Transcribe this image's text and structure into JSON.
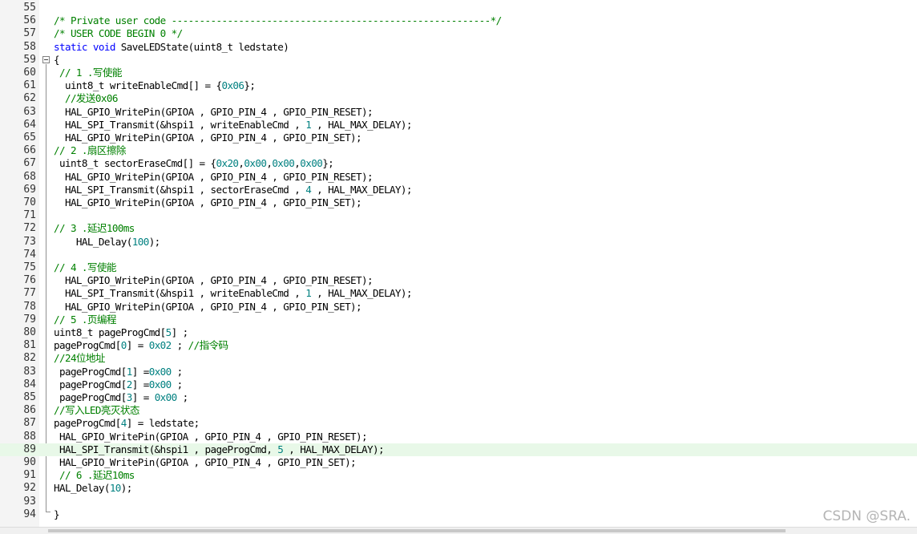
{
  "editor": {
    "current_line": 89,
    "lines": [
      {
        "n": "55",
        "tokens": []
      },
      {
        "n": "56",
        "tokens": [
          {
            "t": "/* Private user code ---------------------------------------------------------*/",
            "c": "cm"
          }
        ]
      },
      {
        "n": "57",
        "tokens": [
          {
            "t": "/* USER CODE BEGIN 0 */",
            "c": "cm"
          }
        ]
      },
      {
        "n": "58",
        "tokens": [
          {
            "t": "static",
            "c": "kw"
          },
          {
            "t": " "
          },
          {
            "t": "void",
            "c": "kw"
          },
          {
            "t": " SaveLEDState(uint8_t ledstate)"
          }
        ]
      },
      {
        "n": "59",
        "tokens": [
          {
            "t": "{"
          }
        ]
      },
      {
        "n": "60",
        "tokens": [
          {
            "t": " // 1 .写使能",
            "c": "cm"
          }
        ]
      },
      {
        "n": "61",
        "tokens": [
          {
            "t": "  uint8_t writeEnableCmd[] = {"
          },
          {
            "t": "0x06",
            "c": "num"
          },
          {
            "t": "};"
          }
        ]
      },
      {
        "n": "62",
        "tokens": [
          {
            "t": "  //发送0x06",
            "c": "cm"
          }
        ]
      },
      {
        "n": "63",
        "tokens": [
          {
            "t": "  HAL_GPIO_WritePin(GPIOA , GPIO_PIN_4 , GPIO_PIN_RESET);"
          }
        ]
      },
      {
        "n": "64",
        "tokens": [
          {
            "t": "  HAL_SPI_Transmit(&hspi1 , writeEnableCmd , "
          },
          {
            "t": "1",
            "c": "num"
          },
          {
            "t": " , HAL_MAX_DELAY);"
          }
        ]
      },
      {
        "n": "65",
        "tokens": [
          {
            "t": "  HAL_GPIO_WritePin(GPIOA , GPIO_PIN_4 , GPIO_PIN_SET);"
          }
        ]
      },
      {
        "n": "66",
        "tokens": [
          {
            "t": "// 2 .扇区擦除",
            "c": "cm"
          }
        ]
      },
      {
        "n": "67",
        "tokens": [
          {
            "t": " uint8_t sectorEraseCmd[] = {"
          },
          {
            "t": "0x20",
            "c": "num"
          },
          {
            "t": ","
          },
          {
            "t": "0x00",
            "c": "num"
          },
          {
            "t": ","
          },
          {
            "t": "0x00",
            "c": "num"
          },
          {
            "t": ","
          },
          {
            "t": "0x00",
            "c": "num"
          },
          {
            "t": "};"
          }
        ]
      },
      {
        "n": "68",
        "tokens": [
          {
            "t": "  HAL_GPIO_WritePin(GPIOA , GPIO_PIN_4 , GPIO_PIN_RESET);"
          }
        ]
      },
      {
        "n": "69",
        "tokens": [
          {
            "t": "  HAL_SPI_Transmit(&hspi1 , sectorEraseCmd , "
          },
          {
            "t": "4",
            "c": "num"
          },
          {
            "t": " , HAL_MAX_DELAY);"
          }
        ]
      },
      {
        "n": "70",
        "tokens": [
          {
            "t": "  HAL_GPIO_WritePin(GPIOA , GPIO_PIN_4 , GPIO_PIN_SET);"
          }
        ]
      },
      {
        "n": "71",
        "tokens": []
      },
      {
        "n": "72",
        "tokens": [
          {
            "t": "// 3 .延迟100ms",
            "c": "cm"
          }
        ]
      },
      {
        "n": "73",
        "tokens": [
          {
            "t": "    HAL_Delay("
          },
          {
            "t": "100",
            "c": "num"
          },
          {
            "t": ");"
          }
        ]
      },
      {
        "n": "74",
        "tokens": []
      },
      {
        "n": "75",
        "tokens": [
          {
            "t": "// 4 .写使能",
            "c": "cm"
          }
        ]
      },
      {
        "n": "76",
        "tokens": [
          {
            "t": "  HAL_GPIO_WritePin(GPIOA , GPIO_PIN_4 , GPIO_PIN_RESET);"
          }
        ]
      },
      {
        "n": "77",
        "tokens": [
          {
            "t": "  HAL_SPI_Transmit(&hspi1 , writeEnableCmd , "
          },
          {
            "t": "1",
            "c": "num"
          },
          {
            "t": " , HAL_MAX_DELAY);"
          }
        ]
      },
      {
        "n": "78",
        "tokens": [
          {
            "t": "  HAL_GPIO_WritePin(GPIOA , GPIO_PIN_4 , GPIO_PIN_SET);"
          }
        ]
      },
      {
        "n": "79",
        "tokens": [
          {
            "t": "// 5 .页编程",
            "c": "cm"
          }
        ]
      },
      {
        "n": "80",
        "tokens": [
          {
            "t": "uint8_t pageProgCmd["
          },
          {
            "t": "5",
            "c": "num"
          },
          {
            "t": "] ;"
          }
        ]
      },
      {
        "n": "81",
        "tokens": [
          {
            "t": "pageProgCmd["
          },
          {
            "t": "0",
            "c": "num"
          },
          {
            "t": "] = "
          },
          {
            "t": "0x02",
            "c": "num"
          },
          {
            "t": " ; "
          },
          {
            "t": "//指令码",
            "c": "cm"
          }
        ]
      },
      {
        "n": "82",
        "tokens": [
          {
            "t": "//24位地址",
            "c": "cm"
          }
        ]
      },
      {
        "n": "83",
        "tokens": [
          {
            "t": " pageProgCmd["
          },
          {
            "t": "1",
            "c": "num"
          },
          {
            "t": "] ="
          },
          {
            "t": "0x00",
            "c": "num"
          },
          {
            "t": " ;"
          }
        ]
      },
      {
        "n": "84",
        "tokens": [
          {
            "t": " pageProgCmd["
          },
          {
            "t": "2",
            "c": "num"
          },
          {
            "t": "] ="
          },
          {
            "t": "0x00",
            "c": "num"
          },
          {
            "t": " ;"
          }
        ]
      },
      {
        "n": "85",
        "tokens": [
          {
            "t": " pageProgCmd["
          },
          {
            "t": "3",
            "c": "num"
          },
          {
            "t": "] = "
          },
          {
            "t": "0x00",
            "c": "num"
          },
          {
            "t": " ;"
          }
        ]
      },
      {
        "n": "86",
        "tokens": [
          {
            "t": "//写入LED亮灭状态",
            "c": "cm"
          }
        ]
      },
      {
        "n": "87",
        "tokens": [
          {
            "t": "pageProgCmd["
          },
          {
            "t": "4",
            "c": "num"
          },
          {
            "t": "] = ledstate;"
          }
        ]
      },
      {
        "n": "88",
        "tokens": [
          {
            "t": " HAL_GPIO_WritePin(GPIOA , GPIO_PIN_4 , GPIO_PIN_RESET);"
          }
        ]
      },
      {
        "n": "89",
        "tokens": [
          {
            "t": " HAL_SPI_Transmit(&hspi1 , pageProgCmd, "
          },
          {
            "t": "5",
            "c": "num"
          },
          {
            "t": " , HAL_MAX_DELAY);"
          }
        ]
      },
      {
        "n": "90",
        "tokens": [
          {
            "t": " HAL_GPIO_WritePin(GPIOA , GPIO_PIN_4 , GPIO_PIN_SET);"
          }
        ]
      },
      {
        "n": "91",
        "tokens": [
          {
            "t": " // 6 .延迟10ms",
            "c": "cm"
          }
        ]
      },
      {
        "n": "92",
        "tokens": [
          {
            "t": "HAL_Delay("
          },
          {
            "t": "10",
            "c": "num"
          },
          {
            "t": ");"
          }
        ]
      },
      {
        "n": "93",
        "tokens": []
      },
      {
        "n": "94",
        "tokens": [
          {
            "t": "}"
          }
        ]
      }
    ]
  },
  "watermark": "CSDN @SRA.",
  "colors": {
    "keyword": "#0000ff",
    "number": "#008080",
    "comment": "#008000",
    "current_line_bg": "#e8f8e8"
  },
  "icons": {
    "fold": "minus-box-icon"
  }
}
